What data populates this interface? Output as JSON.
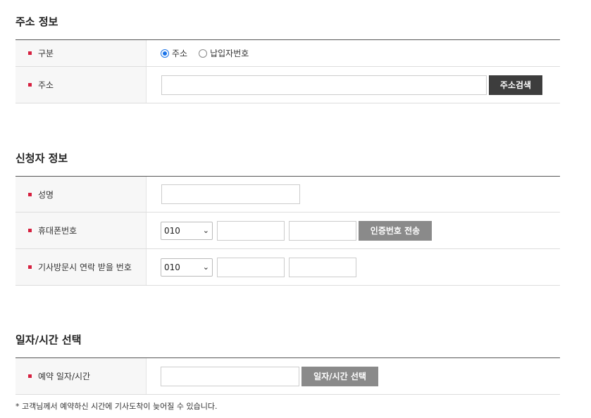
{
  "address_section": {
    "title": "주소 정보",
    "type_label": "구분",
    "radio_address": "주소",
    "radio_parcel": "납입자번호",
    "address_label": "주소",
    "address_value": "",
    "search_button": "주소검색"
  },
  "applicant_section": {
    "title": "신청자 정보",
    "name_label": "성명",
    "name_value": "",
    "phone_label": "휴대폰번호",
    "phone_prefix": "010",
    "verify_button": "인증번호 전송",
    "visit_phone_label": "기사방문시 연락 받을 번호",
    "visit_phone_prefix": "010"
  },
  "schedule_section": {
    "title": "일자/시간 선택",
    "date_label": "예약 일자/시간",
    "date_value": "",
    "select_button": "일자/시간 선택"
  },
  "note": "* 고객님께서 예약하신 시간에 기사도착이 늦어질 수 있습니다.",
  "colors": {
    "bullet": "#d6203f",
    "radio_accent": "#1a73e8",
    "dark_button": "#3d3d3d",
    "gray_button": "#8a8a8a"
  }
}
